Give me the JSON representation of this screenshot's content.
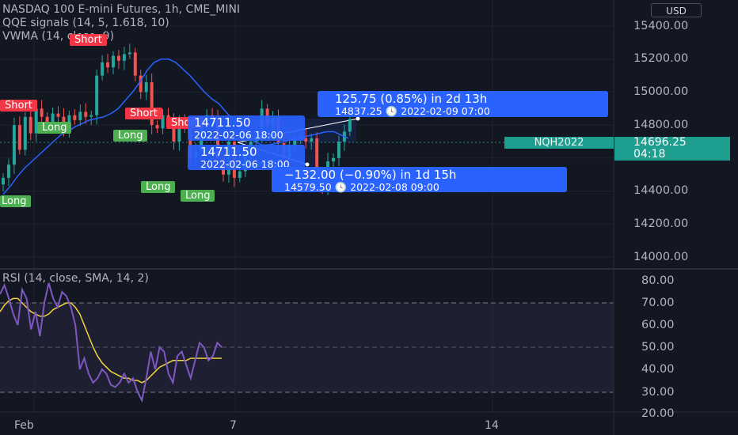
{
  "header": {
    "title": "NASDAQ 100 E-mini Futures, 1h, CME_MINI",
    "indicator1": "QQE signals (14, 5, 1.618, 10)",
    "indicator2": "VWMA (14, close, 9)",
    "currency": "USD"
  },
  "colors": {
    "background": "#131722",
    "up": "#26a69a",
    "down": "#ef5350",
    "vwma": "#2962ff",
    "rsi": "#7e57c2",
    "rsi_ma": "#f0d63c",
    "short": "#f23645",
    "long": "#4caf50",
    "measure": "#2962ff",
    "price_tag": "#1e9e8f"
  },
  "price_axis": {
    "ticks": [
      "15400.00",
      "15200.00",
      "15000.00",
      "14800.00",
      "14600.00",
      "14400.00",
      "14200.00",
      "14000.00"
    ]
  },
  "rsi_axis": {
    "ticks": [
      "80.00",
      "70.00",
      "60.00",
      "50.00",
      "40.00",
      "30.00",
      "20.00"
    ]
  },
  "time_axis": {
    "labels": [
      "Feb",
      "7",
      "14"
    ]
  },
  "symbol_tag": "NQH2022",
  "last_price": "14696.25",
  "countdown": "04:18",
  "rsi_legend": "RSI (14, close, SMA, 14, 2)",
  "signals": {
    "short": "Short",
    "long": "Long"
  },
  "measure_up": {
    "line1": "125.75 (0.85%) in 2d 13h",
    "line2": "14837.25 🕓 2022-02-09 07:00"
  },
  "measure_down": {
    "line1": "−132.00 (−0.90%) in 1d 15h",
    "line2": "14579.50 🕓 2022-02-08 09:00"
  },
  "anchor_top": {
    "line1": "14711.50",
    "line2": "2022-02-06 18:00"
  },
  "anchor_bottom": {
    "line1": "14711.50",
    "line2": "2022-02-06 18:00"
  },
  "chart_data": [
    {
      "type": "candlestick",
      "title": "NASDAQ 100 E-mini Futures, 1h, CME_MINI",
      "ylim": [
        13850,
        15550
      ],
      "x_labels": [
        "Feb",
        "7",
        "14"
      ],
      "close": [
        14480,
        14560,
        14800,
        14650,
        14850,
        14750,
        14900,
        14850,
        14820,
        14870,
        14850,
        14780,
        14860,
        14830,
        14880,
        14850,
        14860,
        15100,
        15180,
        15150,
        15220,
        15190,
        15230,
        15240,
        15100,
        15000,
        15060,
        14800,
        14780,
        14860,
        14820,
        14700,
        14830,
        14780,
        14600,
        14640,
        14820,
        14860,
        14840,
        14600,
        14500,
        14700,
        14480,
        14520,
        14640,
        14700,
        14750,
        14900,
        14800,
        14850,
        14690,
        14600,
        14680,
        14720,
        14720,
        14700,
        14720,
        14480,
        14410,
        14580,
        14600,
        14700,
        14760,
        14837
      ],
      "series": [
        {
          "name": "VWMA",
          "values": [
            14380,
            14430,
            14490,
            14540,
            14580,
            14620,
            14660,
            14700,
            14740,
            14760,
            14790,
            14810,
            14830,
            14840,
            14850,
            14870,
            14900,
            14950,
            15000,
            15060,
            15130,
            15180,
            15200,
            15200,
            15180,
            15140,
            15100,
            15050,
            15000,
            14960,
            14930,
            14880,
            14830,
            14780,
            14740,
            14700,
            14680,
            14680,
            14690,
            14700,
            14710,
            14720,
            14730,
            14740,
            14750,
            14760,
            14760,
            14740,
            14720
          ]
        }
      ]
    },
    {
      "type": "line",
      "title": "RSI (14, close, SMA, 14, 2)",
      "ylim": [
        18,
        84
      ],
      "series": [
        {
          "name": "RSI",
          "values": [
            74,
            78,
            72,
            65,
            60,
            76,
            72,
            58,
            66,
            55,
            70,
            79,
            72,
            68,
            75,
            73,
            68,
            60,
            40,
            45,
            38,
            34,
            36,
            40,
            38,
            33,
            32,
            34,
            38,
            34,
            36,
            30,
            26,
            36,
            48,
            40,
            50,
            48,
            38,
            34,
            46,
            48,
            42,
            36,
            44,
            52,
            50,
            44,
            46,
            52,
            50
          ]
        },
        {
          "name": "SMA",
          "values": [
            66,
            69,
            71,
            72,
            72,
            70,
            68,
            66,
            65,
            64,
            64,
            65,
            67,
            68,
            69,
            70,
            70,
            68,
            65,
            60,
            55,
            50,
            46,
            43,
            41,
            39,
            38,
            37,
            36,
            36,
            35,
            35,
            34,
            35,
            37,
            39,
            41,
            42,
            43,
            44,
            44,
            44,
            44,
            45,
            45,
            45,
            45,
            45,
            45,
            45,
            45
          ]
        }
      ]
    }
  ]
}
